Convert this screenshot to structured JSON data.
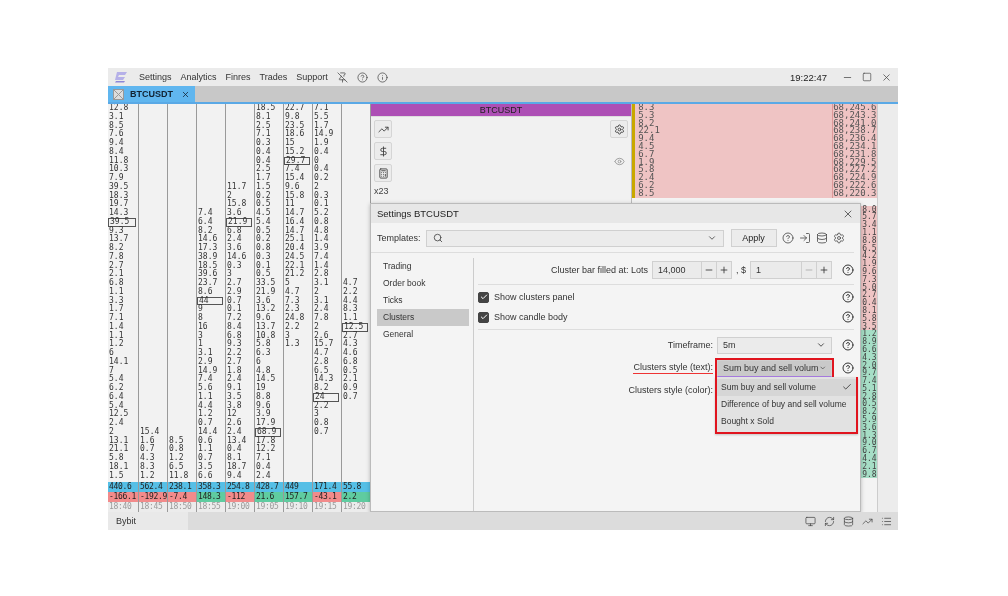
{
  "menu_bar": {
    "items": [
      "Settings",
      "Analytics",
      "Finres",
      "Trades",
      "Support"
    ],
    "time": "19:22:47"
  },
  "tabs": [
    {
      "label": "BTCUSDT",
      "selected": true
    }
  ],
  "clusters": {
    "columns": [
      {
        "time": "18:40",
        "total": "440.6",
        "delta": "-166.1",
        "negative": true,
        "cells": [
          {
            "value": "12.8",
            "boxed": false
          },
          {
            "value": "3.1",
            "boxed": false
          },
          {
            "value": "8.5",
            "boxed": false
          },
          {
            "value": "7.6",
            "boxed": false
          },
          {
            "value": "9.4",
            "boxed": false
          },
          {
            "value": "8.4",
            "boxed": false
          },
          {
            "value": "11.8",
            "boxed": false
          },
          {
            "value": "10.3",
            "boxed": false
          },
          {
            "value": "7.9",
            "boxed": false
          },
          {
            "value": "39.5",
            "boxed": false
          },
          {
            "value": "18.3",
            "boxed": false
          },
          {
            "value": "19.7",
            "boxed": false
          },
          {
            "value": "14.3",
            "boxed": false
          },
          {
            "value": "39.5",
            "boxed": true
          },
          {
            "value": "9.3",
            "boxed": false
          },
          {
            "value": "13.7",
            "boxed": false
          },
          {
            "value": "8.2",
            "boxed": false
          },
          {
            "value": "7.8",
            "boxed": false
          },
          {
            "value": "2.7",
            "boxed": false
          },
          {
            "value": "2.1",
            "boxed": false
          },
          {
            "value": "6.8",
            "boxed": false
          },
          {
            "value": "1.1",
            "boxed": false
          },
          {
            "value": "3.3",
            "boxed": false
          },
          {
            "value": "1.7",
            "boxed": false
          },
          {
            "value": "7.1",
            "boxed": false
          },
          {
            "value": "1.4",
            "boxed": false
          },
          {
            "value": "1.1",
            "boxed": false
          },
          {
            "value": "1.2",
            "boxed": false
          },
          {
            "value": "6",
            "boxed": false
          },
          {
            "value": "14.1",
            "boxed": false
          },
          {
            "value": "7",
            "boxed": false
          },
          {
            "value": "5.4",
            "boxed": false
          },
          {
            "value": "6.2",
            "boxed": false
          },
          {
            "value": "6.4",
            "boxed": false
          },
          {
            "value": "5.4",
            "boxed": false
          },
          {
            "value": "12.5",
            "boxed": false
          },
          {
            "value": "2.4",
            "boxed": false
          },
          {
            "value": "2",
            "boxed": false
          },
          {
            "value": "13.1",
            "boxed": false
          },
          {
            "value": "21.1",
            "boxed": false
          },
          {
            "value": "5.8",
            "boxed": false
          },
          {
            "value": "18.1",
            "boxed": false
          },
          {
            "value": "1.5",
            "boxed": false
          }
        ]
      },
      {
        "time": "18:45",
        "total": "562.4",
        "delta": "-192.9",
        "negative": true,
        "cells": [
          null,
          null,
          null,
          null,
          null,
          null,
          null,
          null,
          null,
          null,
          null,
          null,
          null,
          null,
          null,
          null,
          null,
          null,
          null,
          null,
          null,
          null,
          null,
          null,
          null,
          null,
          null,
          null,
          null,
          null,
          null,
          null,
          null,
          null,
          null,
          null,
          null,
          {
            "value": "15.4",
            "boxed": false
          },
          {
            "value": "1.6",
            "boxed": false
          },
          {
            "value": "0.7",
            "boxed": false
          },
          {
            "value": "4.3",
            "boxed": false
          },
          {
            "value": "8.3",
            "boxed": false
          },
          {
            "value": "1.2",
            "boxed": false
          }
        ]
      },
      {
        "time": "18:50",
        "total": "238.1",
        "delta": "-7.4",
        "negative": true,
        "cells": [
          null,
          null,
          null,
          null,
          null,
          null,
          null,
          null,
          null,
          null,
          null,
          null,
          null,
          null,
          null,
          null,
          null,
          null,
          null,
          null,
          null,
          null,
          null,
          null,
          null,
          null,
          null,
          null,
          null,
          null,
          null,
          null,
          null,
          null,
          null,
          null,
          null,
          null,
          {
            "value": "8.5",
            "boxed": false
          },
          {
            "value": "0.8",
            "boxed": false
          },
          {
            "value": "1.2",
            "boxed": false
          },
          {
            "value": "6.5",
            "boxed": false
          },
          {
            "value": "11.8",
            "boxed": false
          }
        ]
      },
      {
        "time": "18:55",
        "total": "358.3",
        "delta": "148.3",
        "negative": false,
        "cells": [
          null,
          null,
          null,
          null,
          null,
          null,
          null,
          null,
          null,
          null,
          null,
          null,
          {
            "value": "7.4",
            "boxed": false
          },
          {
            "value": "6.4",
            "boxed": false
          },
          {
            "value": "8.2",
            "boxed": false
          },
          {
            "value": "14.6",
            "boxed": false
          },
          {
            "value": "17.3",
            "boxed": false
          },
          {
            "value": "38.9",
            "boxed": false
          },
          {
            "value": "18.5",
            "boxed": false
          },
          {
            "value": "39.6",
            "boxed": false
          },
          {
            "value": "23.7",
            "boxed": false
          },
          {
            "value": "8.6",
            "boxed": false
          },
          {
            "value": "44",
            "boxed": true
          },
          {
            "value": "9",
            "boxed": false
          },
          {
            "value": "8",
            "boxed": false
          },
          {
            "value": "16",
            "boxed": false
          },
          {
            "value": "3",
            "boxed": false
          },
          {
            "value": "1",
            "boxed": false
          },
          {
            "value": "3.1",
            "boxed": false
          },
          {
            "value": "2.9",
            "boxed": false
          },
          {
            "value": "14.9",
            "boxed": false
          },
          {
            "value": "7.4",
            "boxed": false
          },
          {
            "value": "5.6",
            "boxed": false
          },
          {
            "value": "1.1",
            "boxed": false
          },
          {
            "value": "4.4",
            "boxed": false
          },
          {
            "value": "1.2",
            "boxed": false
          },
          {
            "value": "0.7",
            "boxed": false
          },
          {
            "value": "14.4",
            "boxed": false
          },
          {
            "value": "0.6",
            "boxed": false
          },
          {
            "value": "1.1",
            "boxed": false
          },
          {
            "value": "0.7",
            "boxed": false
          },
          {
            "value": "3.5",
            "boxed": false
          },
          {
            "value": "6.6",
            "boxed": false
          }
        ]
      },
      {
        "time": "19:00",
        "total": "254.8",
        "delta": "-112",
        "negative": true,
        "cells": [
          null,
          null,
          null,
          null,
          null,
          null,
          null,
          null,
          null,
          {
            "value": "11.7",
            "boxed": false
          },
          {
            "value": "2",
            "boxed": false
          },
          {
            "value": "15.8",
            "boxed": false
          },
          {
            "value": "3.6",
            "boxed": false
          },
          {
            "value": "21.9",
            "boxed": true
          },
          {
            "value": "6.8",
            "boxed": false
          },
          {
            "value": "2.4",
            "boxed": false
          },
          {
            "value": "3.6",
            "boxed": false
          },
          {
            "value": "14.6",
            "boxed": false
          },
          {
            "value": "0.3",
            "boxed": false
          },
          {
            "value": "3",
            "boxed": false
          },
          {
            "value": "2.7",
            "boxed": false
          },
          {
            "value": "2.9",
            "boxed": false
          },
          {
            "value": "0.7",
            "boxed": false
          },
          {
            "value": "0.1",
            "boxed": false
          },
          {
            "value": "7.2",
            "boxed": false
          },
          {
            "value": "8.4",
            "boxed": false
          },
          {
            "value": "6.8",
            "boxed": false
          },
          {
            "value": "9.3",
            "boxed": false
          },
          {
            "value": "2.2",
            "boxed": false
          },
          {
            "value": "2.7",
            "boxed": false
          },
          {
            "value": "1.8",
            "boxed": false
          },
          {
            "value": "2.4",
            "boxed": false
          },
          {
            "value": "9.1",
            "boxed": false
          },
          {
            "value": "3.5",
            "boxed": false
          },
          {
            "value": "3.8",
            "boxed": false
          },
          {
            "value": "12",
            "boxed": false
          },
          {
            "value": "2.6",
            "boxed": false
          },
          {
            "value": "2.4",
            "boxed": false
          },
          {
            "value": "13.4",
            "boxed": false
          },
          {
            "value": "0.4",
            "boxed": false
          },
          {
            "value": "8.1",
            "boxed": false
          },
          {
            "value": "18.7",
            "boxed": false
          },
          {
            "value": "9.4",
            "boxed": false
          }
        ]
      },
      {
        "time": "19:05",
        "total": "428.7",
        "delta": "21.6",
        "negative": false,
        "cells": [
          {
            "value": "18.5",
            "boxed": false
          },
          {
            "value": "8.1",
            "boxed": false
          },
          {
            "value": "2.5",
            "boxed": false
          },
          {
            "value": "7.1",
            "boxed": false
          },
          {
            "value": "0.3",
            "boxed": false
          },
          {
            "value": "0.4",
            "boxed": false
          },
          {
            "value": "0.4",
            "boxed": false
          },
          {
            "value": "2.5",
            "boxed": false
          },
          {
            "value": "1.7",
            "boxed": false
          },
          {
            "value": "1.5",
            "boxed": false
          },
          {
            "value": "0.2",
            "boxed": false
          },
          {
            "value": "0.5",
            "boxed": false
          },
          {
            "value": "4.5",
            "boxed": false
          },
          {
            "value": "5.4",
            "boxed": false
          },
          {
            "value": "0.5",
            "boxed": false
          },
          {
            "value": "0.2",
            "boxed": false
          },
          {
            "value": "0.8",
            "boxed": false
          },
          {
            "value": "0.3",
            "boxed": false
          },
          {
            "value": "0.1",
            "boxed": false
          },
          {
            "value": "0.5",
            "boxed": false
          },
          {
            "value": "33.5",
            "boxed": false
          },
          {
            "value": "21.9",
            "boxed": false
          },
          {
            "value": "3.6",
            "boxed": false
          },
          {
            "value": "13.2",
            "boxed": false
          },
          {
            "value": "9.6",
            "boxed": false
          },
          {
            "value": "13.7",
            "boxed": false
          },
          {
            "value": "10.8",
            "boxed": false
          },
          {
            "value": "5.8",
            "boxed": false
          },
          {
            "value": "6.3",
            "boxed": false
          },
          {
            "value": "6",
            "boxed": false
          },
          {
            "value": "4.8",
            "boxed": false
          },
          {
            "value": "14.5",
            "boxed": false
          },
          {
            "value": "19",
            "boxed": false
          },
          {
            "value": "8.8",
            "boxed": false
          },
          {
            "value": "9.6",
            "boxed": false
          },
          {
            "value": "3.9",
            "boxed": false
          },
          {
            "value": "17.9",
            "boxed": false
          },
          {
            "value": "68.9",
            "boxed": true
          },
          {
            "value": "17.8",
            "boxed": false
          },
          {
            "value": "12.2",
            "boxed": false
          },
          {
            "value": "7.1",
            "boxed": false
          },
          {
            "value": "0.4",
            "boxed": false
          },
          {
            "value": "2.4",
            "boxed": false
          }
        ]
      },
      {
        "time": "19:10",
        "total": "449",
        "delta": "157.7",
        "negative": false,
        "cells": [
          {
            "value": "22.7",
            "boxed": false
          },
          {
            "value": "9.8",
            "boxed": false
          },
          {
            "value": "23.5",
            "boxed": false
          },
          {
            "value": "18.6",
            "boxed": false
          },
          {
            "value": "15",
            "boxed": false
          },
          {
            "value": "15.2",
            "boxed": false
          },
          {
            "value": "29.7",
            "boxed": true
          },
          {
            "value": "7.4",
            "boxed": false
          },
          {
            "value": "15.4",
            "boxed": false
          },
          {
            "value": "9.6",
            "boxed": false
          },
          {
            "value": "15.8",
            "boxed": false
          },
          {
            "value": "11",
            "boxed": false
          },
          {
            "value": "14.7",
            "boxed": false
          },
          {
            "value": "16.4",
            "boxed": false
          },
          {
            "value": "14.7",
            "boxed": false
          },
          {
            "value": "25.1",
            "boxed": false
          },
          {
            "value": "20.4",
            "boxed": false
          },
          {
            "value": "24.5",
            "boxed": false
          },
          {
            "value": "22.1",
            "boxed": false
          },
          {
            "value": "21.2",
            "boxed": false
          },
          {
            "value": "5",
            "boxed": false
          },
          {
            "value": "4.7",
            "boxed": false
          },
          {
            "value": "7.3",
            "boxed": false
          },
          {
            "value": "2.3",
            "boxed": false
          },
          {
            "value": "24.8",
            "boxed": false
          },
          {
            "value": "2.2",
            "boxed": false
          },
          {
            "value": "3",
            "boxed": false
          },
          {
            "value": "1.3",
            "boxed": false
          }
        ]
      },
      {
        "time": "19:15",
        "total": "171.4",
        "delta": "-43.1",
        "negative": true,
        "cells": [
          {
            "value": "7.1",
            "boxed": false
          },
          {
            "value": "5.5",
            "boxed": false
          },
          {
            "value": "1.7",
            "boxed": false
          },
          {
            "value": "14.9",
            "boxed": false
          },
          {
            "value": "1.9",
            "boxed": false
          },
          {
            "value": "0.4",
            "boxed": false
          },
          {
            "value": "0",
            "boxed": false
          },
          {
            "value": "0.4",
            "boxed": false
          },
          {
            "value": "0.2",
            "boxed": false
          },
          {
            "value": "2",
            "boxed": false
          },
          {
            "value": "0.3",
            "boxed": false
          },
          {
            "value": "0.1",
            "boxed": false
          },
          {
            "value": "5.2",
            "boxed": false
          },
          {
            "value": "0.8",
            "boxed": false
          },
          {
            "value": "4.8",
            "boxed": false
          },
          {
            "value": "1.4",
            "boxed": false
          },
          {
            "value": "3.9",
            "boxed": false
          },
          {
            "value": "7.4",
            "boxed": false
          },
          {
            "value": "1.4",
            "boxed": false
          },
          {
            "value": "2.8",
            "boxed": false
          },
          {
            "value": "3.1",
            "boxed": false
          },
          {
            "value": "2",
            "boxed": false
          },
          {
            "value": "3.1",
            "boxed": false
          },
          {
            "value": "2.4",
            "boxed": false
          },
          {
            "value": "7.8",
            "boxed": false
          },
          {
            "value": "2",
            "boxed": false
          },
          {
            "value": "2.6",
            "boxed": false
          },
          {
            "value": "15.7",
            "boxed": false
          },
          {
            "value": "4.7",
            "boxed": false
          },
          {
            "value": "2.8",
            "boxed": false
          },
          {
            "value": "6.5",
            "boxed": false
          },
          {
            "value": "14.3",
            "boxed": false
          },
          {
            "value": "8.2",
            "boxed": false
          },
          {
            "value": "24",
            "boxed": true
          },
          {
            "value": "2.2",
            "boxed": false
          },
          {
            "value": "3",
            "boxed": false
          },
          {
            "value": "0.8",
            "boxed": false
          },
          {
            "value": "0.7",
            "boxed": false
          }
        ]
      },
      {
        "time": "19:20",
        "total": "55.8",
        "delta": "2.2",
        "negative": false,
        "cells": [
          null,
          null,
          null,
          null,
          null,
          null,
          null,
          null,
          null,
          null,
          null,
          null,
          null,
          null,
          null,
          null,
          null,
          null,
          null,
          null,
          {
            "value": "4.7",
            "boxed": false
          },
          {
            "value": "2.2",
            "boxed": false
          },
          {
            "value": "4.4",
            "boxed": false
          },
          {
            "value": "8.3",
            "boxed": false
          },
          {
            "value": "1.1",
            "boxed": false
          },
          {
            "value": "12.5",
            "boxed": true
          },
          {
            "value": "2.7",
            "boxed": false
          },
          {
            "value": "4.3",
            "boxed": false
          },
          {
            "value": "4.6",
            "boxed": false
          },
          {
            "value": "6.8",
            "boxed": false
          },
          {
            "value": "0.5",
            "boxed": false
          },
          {
            "value": "2.1",
            "boxed": false
          },
          {
            "value": "0.9",
            "boxed": false
          },
          {
            "value": "0.7",
            "boxed": false
          }
        ]
      }
    ]
  },
  "chart_panel": {
    "title": "BTCUSDT",
    "multiplier": "x23"
  },
  "order_book": {
    "rows": [
      {
        "volume": "8.3",
        "price": "68,245.6"
      },
      {
        "volume": "5.3",
        "price": "68,243.3"
      },
      {
        "volume": "8.2",
        "price": "68,241.0"
      },
      {
        "volume": "22.1",
        "price": "68,238.7"
      },
      {
        "volume": "9.4",
        "price": "68,236.4"
      },
      {
        "volume": "4.5",
        "price": "68,234.1"
      },
      {
        "volume": "6.7",
        "price": "68,231.8"
      },
      {
        "volume": "1.9",
        "price": "68,229.5"
      },
      {
        "volume": "5.8",
        "price": "68,227.2"
      },
      {
        "volume": "2.4",
        "price": "68,224.9"
      },
      {
        "volume": "6.2",
        "price": "68,222.6"
      },
      {
        "volume": "8.5",
        "price": "68,220.3"
      }
    ],
    "price_fragments": [
      {
        "text": "8.0",
        "bid": false
      },
      {
        "text": "5.7",
        "bid": false
      },
      {
        "text": "3.4",
        "bid": false
      },
      {
        "text": "1.1",
        "bid": false
      },
      {
        "text": "8.8",
        "bid": false
      },
      {
        "text": "6.5",
        "bid": false
      },
      {
        "text": "4.2",
        "bid": false
      },
      {
        "text": "1.9",
        "bid": false
      },
      {
        "text": "9.6",
        "bid": false
      },
      {
        "text": "7.3",
        "bid": false
      },
      {
        "text": "5.0",
        "bid": false
      },
      {
        "text": "2.7",
        "bid": false
      },
      {
        "text": "0.4",
        "bid": false
      },
      {
        "text": "8.1",
        "bid": false
      },
      {
        "text": "5.8",
        "bid": false
      },
      {
        "text": "3.5",
        "bid": false
      },
      {
        "text": "1.2",
        "bid": true
      },
      {
        "text": "8.9",
        "bid": true
      },
      {
        "text": "6.6",
        "bid": true
      },
      {
        "text": "4.3",
        "bid": true
      },
      {
        "text": "2.0",
        "bid": true
      },
      {
        "text": "9.7",
        "bid": true
      },
      {
        "text": "7.4",
        "bid": true
      },
      {
        "text": "5.1",
        "bid": true
      },
      {
        "text": "2.8",
        "bid": true
      },
      {
        "text": "0.5",
        "bid": true
      },
      {
        "text": "8.2",
        "bid": true
      },
      {
        "text": "5.9",
        "bid": true
      },
      {
        "text": "3.6",
        "bid": true
      },
      {
        "text": "1.3",
        "bid": true
      },
      {
        "text": "9.0",
        "bid": true
      },
      {
        "text": "6.7",
        "bid": true
      },
      {
        "text": "4.4",
        "bid": true
      },
      {
        "text": "2.1",
        "bid": true
      },
      {
        "text": "9.8",
        "bid": true
      }
    ]
  },
  "settings_dialog": {
    "title": "Settings BTCUSDT",
    "templates_label": "Templates:",
    "apply": "Apply",
    "nav": [
      {
        "label": "Trading",
        "selected": false
      },
      {
        "label": "Order book",
        "selected": false
      },
      {
        "label": "Ticks",
        "selected": false
      },
      {
        "label": "Clusters",
        "selected": true
      },
      {
        "label": "General",
        "selected": false
      }
    ],
    "cluster_bar": {
      "label": "Cluster bar filled at: Lots",
      "lots": "14,000",
      "dollar_label": ", $",
      "dollar": "1",
      "dollar_minus_disabled": true
    },
    "checkboxes": [
      {
        "label": "Show clusters panel",
        "checked": true
      },
      {
        "label": "Show candle body",
        "checked": true
      }
    ],
    "timeframe": {
      "label": "Timeframe:",
      "value": "5m"
    },
    "clusters_text": {
      "label": "Clusters style (text):",
      "value": "Sum buy and sell volum",
      "highlighted": true,
      "expanded": true,
      "options": [
        {
          "label": "Sum buy and sell volume",
          "selected": true
        },
        {
          "label": "Difference of buy and sell volume",
          "selected": false
        },
        {
          "label": "Bought x Sold",
          "selected": false
        }
      ]
    },
    "clusters_color": {
      "label": "Clusters style (color):"
    }
  },
  "status_bar": {
    "exchange": "Bybit"
  }
}
